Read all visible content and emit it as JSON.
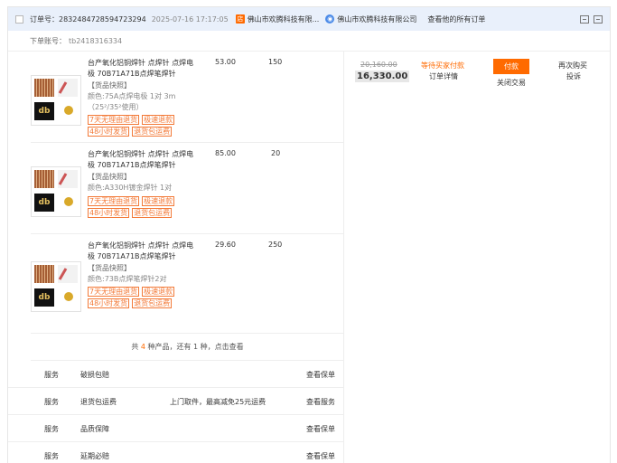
{
  "header": {
    "order_no": "订单号：2832484728594723294",
    "time": "2025-07-16 17:17:05",
    "shop_name": "佛山市欢腾科技有限...",
    "shop_chat": "佛山市欢腾科技有限公司",
    "all_orders": "查看他的所有订单"
  },
  "account": {
    "label": "下单账号：",
    "value": "tb2418316334"
  },
  "items": [
    {
      "title": "台产氧化铝铜焊针 点焊针 点焊电极 70B71A71B点焊笔焊针",
      "snapshot": "【货品快照】",
      "sku": "颜色:75A点焊电极 1对 3m（25²/35²使用）",
      "tags": [
        "7天无理由退货",
        "极速退款",
        "48小时发货",
        "退货包运费"
      ],
      "price": "53.00",
      "qty": "150"
    },
    {
      "title": "台产氧化铝铜焊针 点焊针 点焊电极 70B71A71B点焊笔焊针",
      "snapshot": "【货品快照】",
      "sku": "颜色:A330H镀金焊针 1对",
      "tags": [
        "7天无理由退货",
        "极速退款",
        "48小时发货",
        "退货包运费"
      ],
      "price": "85.00",
      "qty": "20"
    },
    {
      "title": "台产氧化铝铜焊针 点焊针 点焊电极 70B71A71B点焊笔焊针",
      "snapshot": "【货品快照】",
      "sku": "颜色:73B点焊笔焊针2对",
      "tags": [
        "7天无理由退货",
        "极速退款",
        "48小时发货",
        "退货包运费"
      ],
      "price": "29.60",
      "qty": "250"
    }
  ],
  "more": {
    "prefix": "共 ",
    "count": "4",
    "suffix": " 种产品，还有 1 种，点击查看"
  },
  "services": [
    {
      "label": "服务",
      "name": "破损包赔",
      "desc": "",
      "action": "查看保单"
    },
    {
      "label": "服务",
      "name": "退货包运费",
      "desc": "上门取件，最高减免25元运费",
      "action": "查看服务"
    },
    {
      "label": "服务",
      "name": "品质保障",
      "desc": "",
      "action": "查看保单"
    },
    {
      "label": "服务",
      "name": "延期必赔",
      "desc": "",
      "action": "查看保单"
    }
  ],
  "summary": {
    "original_price": "20,160.00",
    "paid_price": "16,330.00",
    "status": "等待买家付款",
    "detail": "订单详情",
    "pay_button": "付款",
    "close": "关闭交易",
    "rebuy": "再次购买",
    "complain": "投诉"
  },
  "colors": {
    "accent": "#ff6a00",
    "header_bg": "#e9f0fb",
    "tag": "#f37a38"
  },
  "icons": [
    "shop-icon",
    "wangwang-chat-icon",
    "message-icon",
    "delete-icon"
  ]
}
